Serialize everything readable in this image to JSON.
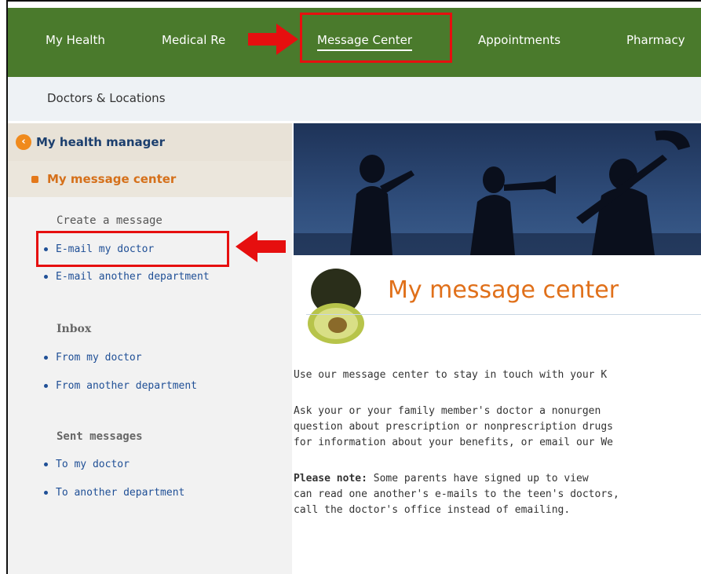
{
  "topnav": {
    "items": [
      "My Health",
      "Medical Re",
      "Message Center",
      "Appointments",
      "Pharmacy"
    ],
    "active": "Message Center"
  },
  "subnav": {
    "doctors_locations": "Doctors & Locations"
  },
  "sidebar": {
    "header": "My health manager",
    "current": "My message center",
    "create_title": "Create a message",
    "create_links": [
      "E-mail my doctor",
      "E-mail another department"
    ],
    "inbox_title": "Inbox",
    "inbox_links": [
      "From my doctor",
      "From another department"
    ],
    "sent_title": "Sent messages",
    "sent_links": [
      "To my doctor",
      "To another department"
    ]
  },
  "main": {
    "heading": "My message center",
    "para1": "Use our message center to stay in touch with your K",
    "para2_lines": [
      "Ask your or your family member's doctor a nonurgen",
      "question about prescription or nonprescription drugs",
      "for information about your benefits, or email our We"
    ],
    "note_label": "Please note:",
    "note_line1_rest": " Some parents have signed up to view",
    "note_lines": [
      "can read one another's e-mails to the teen's doctors,",
      "call the doctor's office instead of emailing."
    ]
  },
  "colors": {
    "nav_green": "#4a7a2c",
    "accent_orange": "#e0701a",
    "link_blue": "#1f4f96",
    "annotation_red": "#e60f0f"
  },
  "icons": {
    "back": "chevron-left-icon",
    "current": "square-bullet-icon",
    "annotation": "red-arrow-icon"
  }
}
